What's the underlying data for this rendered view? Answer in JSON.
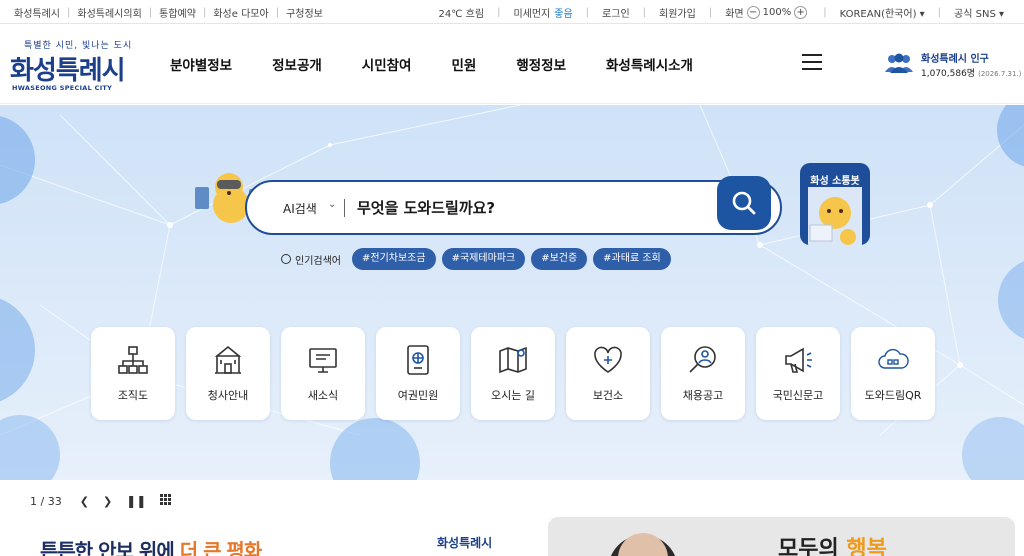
{
  "topbar": {
    "links": [
      "화성특례시",
      "화성특례시의회",
      "통합예약",
      "화성e 다모아",
      "구청정보"
    ],
    "weather": "24℃ 흐림",
    "dust_label": "미세먼지",
    "dust_value": "좋음",
    "login": "로그인",
    "join": "회원가입",
    "screen_label": "화면",
    "zoom_minus": "−",
    "zoom": "100%",
    "zoom_plus": "+",
    "language": "KOREAN(한국어) ▾",
    "sns": "공식 SNS ▾"
  },
  "header": {
    "slogan": "특별한 시민, 빛나는 도시",
    "logo_text": "화성특례시",
    "logo_eng": "HWASEONG SPECIAL CITY",
    "menu": [
      "분야별정보",
      "정보공개",
      "시민참여",
      "민원",
      "행정정보",
      "화성특례시소개"
    ],
    "population_title": "화성특례시 인구",
    "population_value": "1,070,586명",
    "population_date": "(2026.7.31.)"
  },
  "hero": {
    "search_mode": "AI검색",
    "search_placeholder": "무엇을 도와드릴까요?",
    "chatbot_title": "화성 소통봇",
    "popular_label": "인기검색어",
    "popular_tags": [
      "#전기차보조금",
      "#국제테마파크",
      "#보건증",
      "#과태료 조회"
    ],
    "quick_links": [
      {
        "label": "조직도",
        "icon": "org-chart-icon"
      },
      {
        "label": "청사안내",
        "icon": "building-icon"
      },
      {
        "label": "새소식",
        "icon": "monitor-news-icon"
      },
      {
        "label": "여권민원",
        "icon": "passport-icon"
      },
      {
        "label": "오시는 길",
        "icon": "map-icon"
      },
      {
        "label": "보건소",
        "icon": "health-heart-icon"
      },
      {
        "label": "채용공고",
        "icon": "search-person-icon"
      },
      {
        "label": "국민신문고",
        "icon": "megaphone-icon"
      },
      {
        "label": "도와드림QR",
        "icon": "cloud-qr-icon"
      }
    ]
  },
  "slider": {
    "current": "1",
    "separator": "/",
    "total": "33"
  },
  "banners": {
    "left_text_a": "튼튼한 안보 위에 ",
    "left_text_b": "더 큰 평화",
    "left_logo": "화성특례시",
    "right_text_a": "모두의 ",
    "right_text_b": "행복"
  },
  "colors": {
    "brand": "#1b3f8b",
    "accent": "#1e55a3",
    "tag": "#2f5fa8",
    "good": "#1a7fd6"
  }
}
